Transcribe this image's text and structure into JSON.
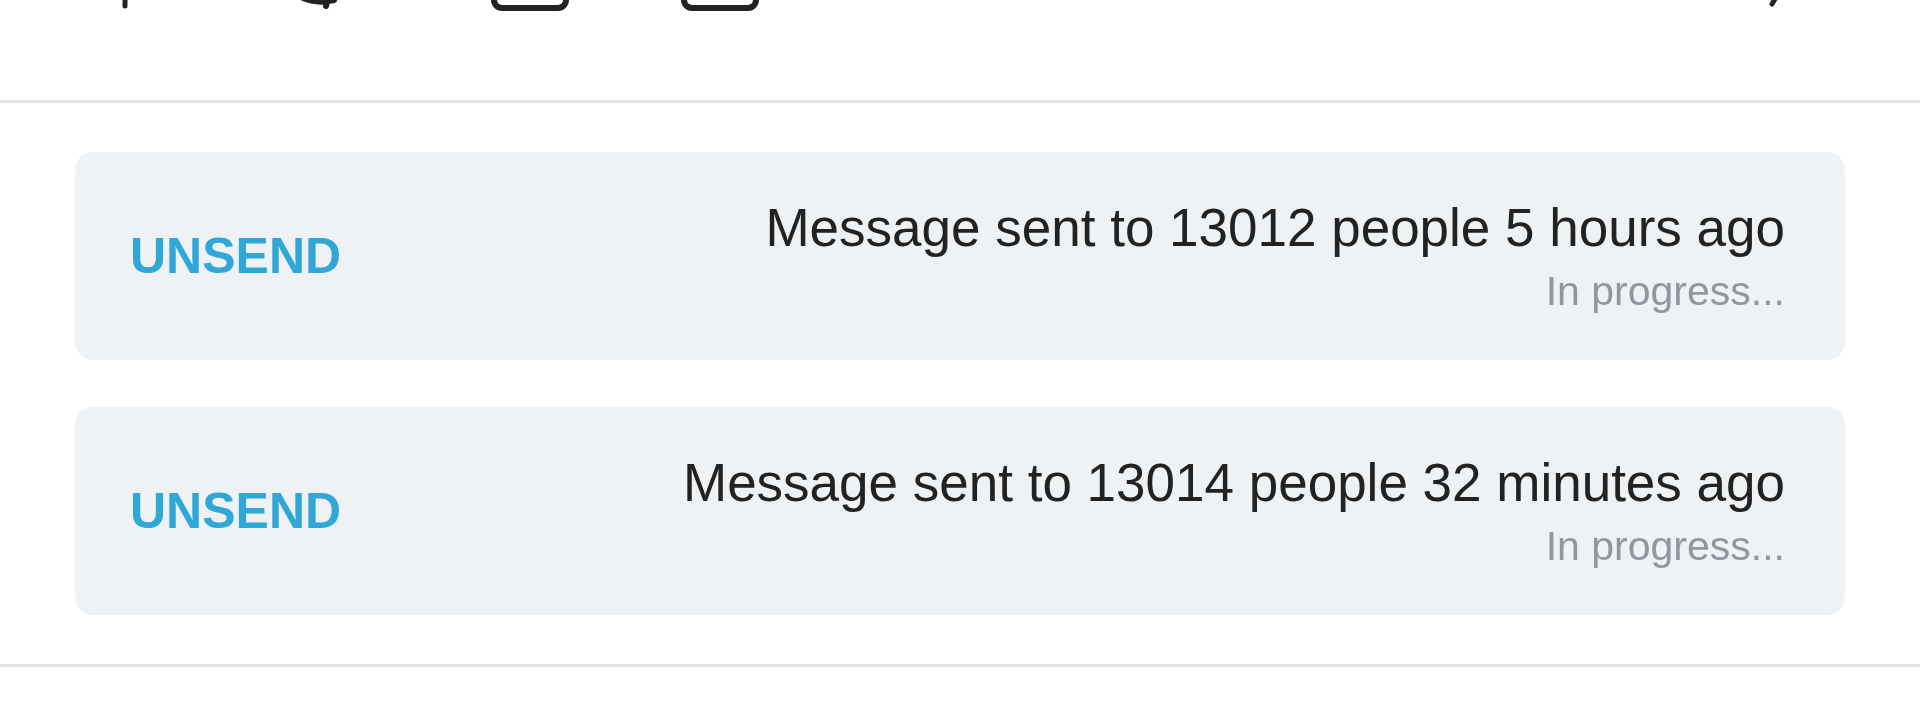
{
  "messages": [
    {
      "text": "Message sent to 13012 people 5 hours ago",
      "status": "In progress...",
      "action": "UNSEND"
    },
    {
      "text": "Message sent to 13014 people 32 minutes ago",
      "status": "In progress...",
      "action": "UNSEND"
    }
  ]
}
